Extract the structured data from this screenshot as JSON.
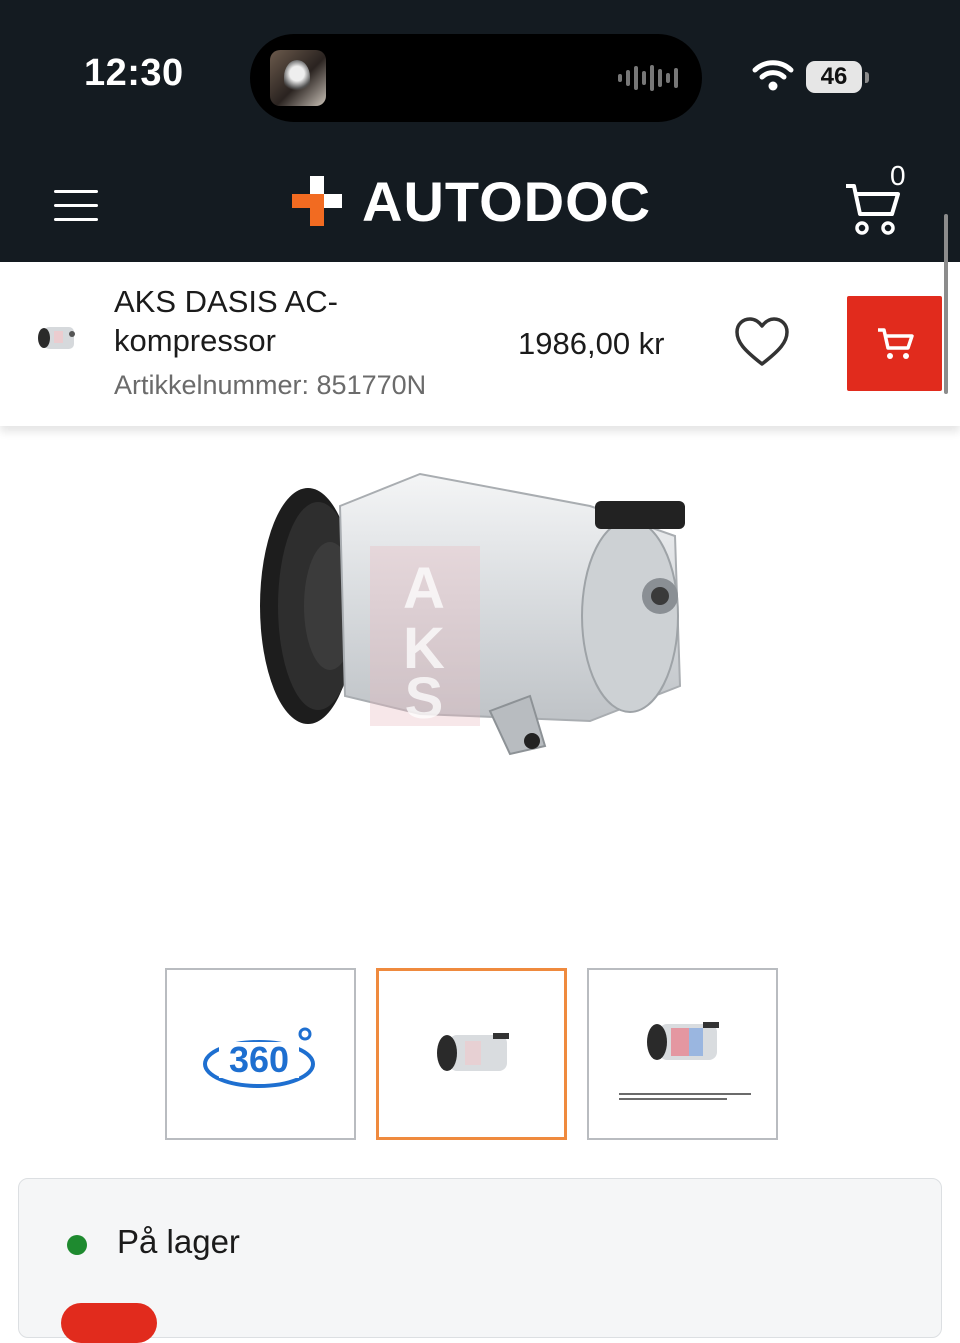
{
  "status_bar": {
    "time": "12:30",
    "battery": "46"
  },
  "header": {
    "logo": "AUTODOC",
    "cart_count": "0"
  },
  "product": {
    "title": "AKS DASIS AC-kompressor",
    "sku": "Artikkelnummer: 851770N",
    "price": "1986,00 kr"
  },
  "main_image": {
    "watermark": "AKS"
  },
  "thumbnails": {
    "items": [
      {
        "label": "360°",
        "type": "360-view"
      },
      {
        "label": "",
        "type": "image",
        "active": true
      },
      {
        "label": "",
        "type": "image-with-caption"
      }
    ]
  },
  "availability": {
    "label": "På lager"
  },
  "colors": {
    "header_bg": "#141b21",
    "accent_red": "#e12b1d",
    "logo_orange": "#f26b21",
    "active_thumb": "#ef8a3e",
    "stock_green": "#1e8a2f",
    "link_blue": "#1e6fd0"
  }
}
